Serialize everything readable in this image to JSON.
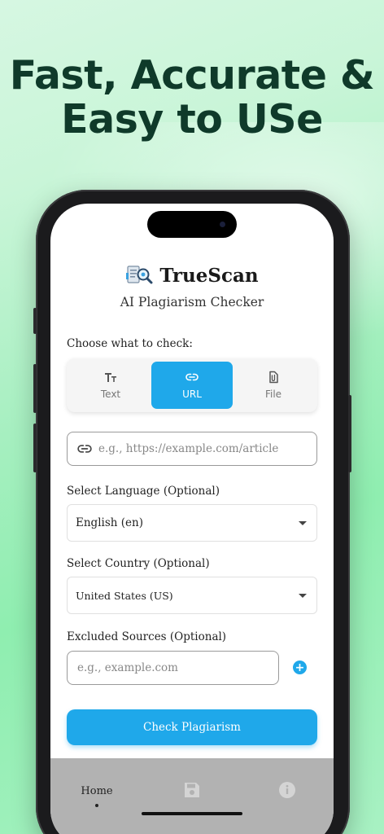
{
  "headline": {
    "line1": "Fast, Accurate &",
    "line2": "Easy to USe"
  },
  "app": {
    "name": "TrueScan",
    "subtitle": "AI Plagiarism Checker",
    "logo_icon": "document-magnifier-icon"
  },
  "check_type": {
    "label": "Choose what to check:",
    "options": [
      {
        "label": "Text",
        "icon": "text-icon",
        "selected": false
      },
      {
        "label": "URL",
        "icon": "link-icon",
        "selected": true
      },
      {
        "label": "File",
        "icon": "file-icon",
        "selected": false
      }
    ]
  },
  "url_input": {
    "placeholder": "e.g., https://example.com/article",
    "icon": "link-icon"
  },
  "language": {
    "label": "Select Language (Optional)",
    "value": "English (en)"
  },
  "country": {
    "label": "Select Country (Optional)",
    "value": "United States (US)"
  },
  "excluded": {
    "label": "Excluded Sources (Optional)",
    "placeholder": "e.g., example.com",
    "add_icon": "plus-circle-icon"
  },
  "submit": {
    "label": "Check Plagiarism"
  },
  "tabbar": {
    "home_label": "Home",
    "save_icon": "floppy-disk-icon",
    "info_icon": "info-icon"
  },
  "colors": {
    "accent": "#1fa8ea",
    "headline": "#0f3a2a",
    "tabbar": "#b2b2b2"
  }
}
